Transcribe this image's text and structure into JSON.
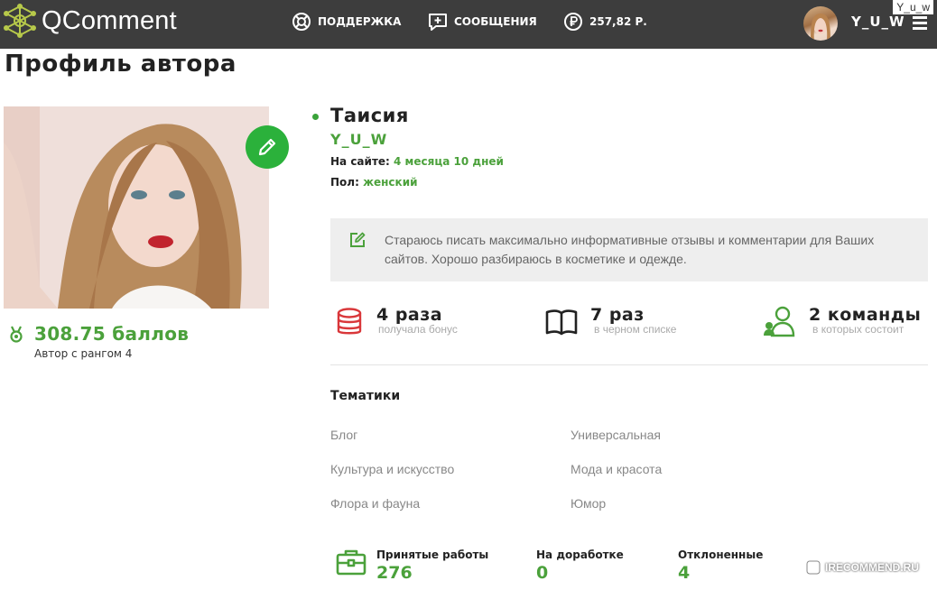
{
  "header": {
    "logo": "QComment",
    "support": "ПОДДЕРЖКА",
    "messages": "СООБЩЕНИЯ",
    "balance": "257,82 Р.",
    "username": "Y_U_W",
    "corner_label": "Y_u_w"
  },
  "page": {
    "title": "Профиль автора"
  },
  "profile": {
    "points": "308.75 баллов",
    "rank": "Автор с рангом 4",
    "name": "Таисия",
    "login": "Y_U_W",
    "on_site_label": "На сайте:",
    "on_site_value": "4 месяца 10 дней",
    "gender_label": "Пол:",
    "gender_value": "женский",
    "about": "Стараюсь писать максимально информативные отзывы и комментарии для Ваших сайтов. Хорошо разбираюсь в косметике и одежде."
  },
  "stats": [
    {
      "value": "4 раза",
      "caption": "получала бонус",
      "icon": "coins-icon"
    },
    {
      "value": "7 раз",
      "caption": "в черном списке",
      "icon": "book-icon"
    },
    {
      "value": "2 команды",
      "caption": "в которых состоит",
      "icon": "team-icon"
    }
  ],
  "themes": {
    "title": "Тематики",
    "items": [
      "Блог",
      "Универсальная",
      "Культура и искусство",
      "Мода и красота",
      "Флора и фауна",
      "Юмор"
    ]
  },
  "works": [
    {
      "label": "Принятые работы",
      "value": "276"
    },
    {
      "label": "На доработке",
      "value": "0"
    },
    {
      "label": "Отклоненные",
      "value": "4"
    }
  ],
  "watermark": "IRECOMMEND.RU",
  "colors": {
    "topbar": "#3d3d3d",
    "accent": "#4ba13b",
    "edit_button": "#2bb13b",
    "coins_icon": "#d9373a"
  }
}
